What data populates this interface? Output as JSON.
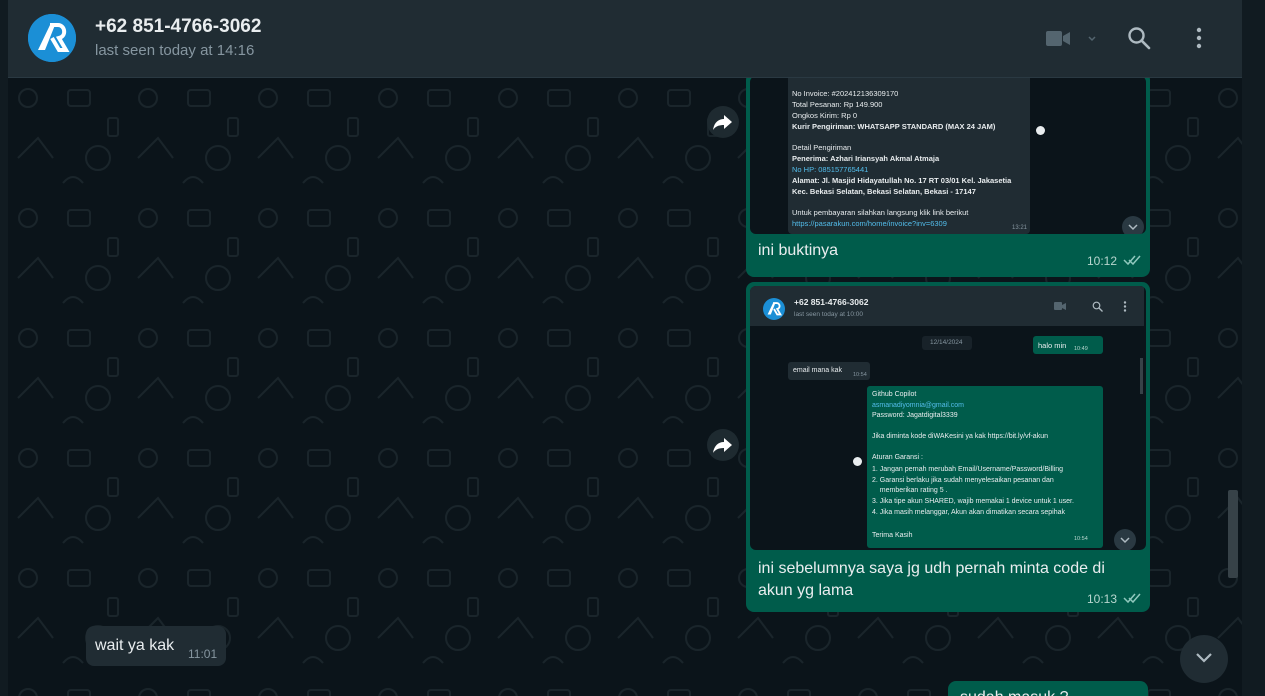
{
  "header": {
    "contact_name": "+62 851-4766-3062",
    "status": "last seen today at 14:16",
    "icons": [
      "video-call-icon",
      "search-icon",
      "menu-icon"
    ]
  },
  "messages": [
    {
      "direction": "outgoing",
      "type": "image",
      "caption": "ini buktinya",
      "time": "10:12",
      "image": {
        "kind": "invoice-screenshot",
        "lines": [
          "No Invoice: #202412136309170",
          "Total Pesanan: Rp 149.900",
          "Ongkos Kirim: Rp 0",
          "Kurir Pengiriman: WHATSAPP STANDARD (MAX 24 JAM)",
          "Detail Pengiriman",
          "Penerima: Azhari Iriansyah Akmal Atmaja",
          "No HP: 085157765441",
          "Alamat: Jl. Masjid Hidayatullah No. 17 RT 03/01 Kel. Jakasetia",
          "Kec. Bekasi Selatan, Bekasi Selatan, Bekasi - 17147",
          "Untuk pembayaran silahkan langsung klik link berikut",
          "https://pasarakun.com/home/invoice?inv=6309"
        ],
        "inner_time": "13:21"
      }
    },
    {
      "direction": "outgoing",
      "type": "image",
      "caption": "ini sebelumnya saya jg udh pernah minta code di akun yg lama",
      "time": "10:13",
      "image": {
        "kind": "chat-screenshot",
        "contact_name": "+62 851-4766-3062",
        "status": "last seen today at 10:00",
        "date_chip": "12/14/2024",
        "out1": "halo min",
        "out1_time": "10:49",
        "in1": "email mana kak",
        "in1_time": "10:54",
        "out2_lines": [
          "Github Copilot",
          "asmanadiyomnia@gmail.com",
          "Password: Jagatdigital3339",
          "",
          "Jika diminta kode diWAKesini ya kak https://bit.ly/vf-akun",
          "",
          "Aturan Garansi :",
          "1. Jangan pernah merubah Email/Username/Password/Billing",
          "2. Garansi berlaku jika sudah menyelesaikan pesanan dan",
          "    memberikan rating 5 .",
          "3. Jika tipe akun SHARED, wajib memakai 1 device untuk 1 user.",
          "4. Jika masih melanggar, Akun akan dimatikan secara sepihak",
          "",
          "Terima Kasih"
        ],
        "out2_time": "10:54"
      }
    },
    {
      "direction": "incoming",
      "type": "text",
      "text": "wait ya kak",
      "time": "11:01"
    },
    {
      "direction": "outgoing",
      "type": "text",
      "text": "sudah masuk ?",
      "partial": true
    }
  ]
}
